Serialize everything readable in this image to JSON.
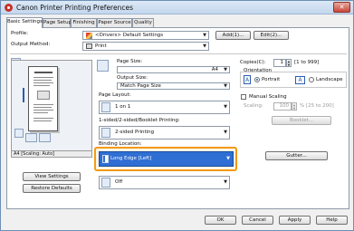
{
  "window": {
    "title": "Canon Printer Printing Preferences",
    "close_label": "✕"
  },
  "tabs": [
    "Basic Settings",
    "Page Setup",
    "Finishing",
    "Paper Source",
    "Quality"
  ],
  "profile": {
    "label": "Profile:",
    "value": "<Drivers> Default Settings",
    "add_label": "Add(1)...",
    "edit_label": "Edit(2)..."
  },
  "output_method": {
    "label": "Output Method:",
    "value": "Print"
  },
  "page_size": {
    "label": "Page Size:",
    "value": "A4"
  },
  "output_size": {
    "label": "Output Size:",
    "value": "Match Page Size"
  },
  "page_layout": {
    "label": "Page Layout:",
    "value": "1 on 1"
  },
  "printing": {
    "label": "1-sided/2-sided/Booklet Printing:",
    "value": "2-sided Printing"
  },
  "binding": {
    "label": "Binding Location:",
    "value": "Long Edge [Left]",
    "gutter_label": "Gutter..."
  },
  "staple": {
    "value": "Off"
  },
  "copies": {
    "label": "Copies(C):",
    "value": "1",
    "range": "[1 to 999]"
  },
  "orientation": {
    "label": "Orientation",
    "portrait": "Portrait",
    "landscape": "Landscape",
    "portrait_letter": "A",
    "landscape_letter": "A"
  },
  "manual_scaling": {
    "label": "Manual Scaling",
    "scaling_label": "Scaling:",
    "value": "100",
    "range": "% [25 to 200]"
  },
  "booklet": {
    "label": "Booklet..."
  },
  "preview": {
    "status": "A4 [Scaling: Auto]"
  },
  "view_settings": {
    "label": "View Settings"
  },
  "restore_defaults": {
    "label": "Restore Defaults"
  },
  "footer": {
    "ok": "OK",
    "cancel": "Cancel",
    "apply": "Apply",
    "help": "Help"
  },
  "colors": {
    "accent": "#2f6fd4",
    "highlight": "#f29a13"
  }
}
